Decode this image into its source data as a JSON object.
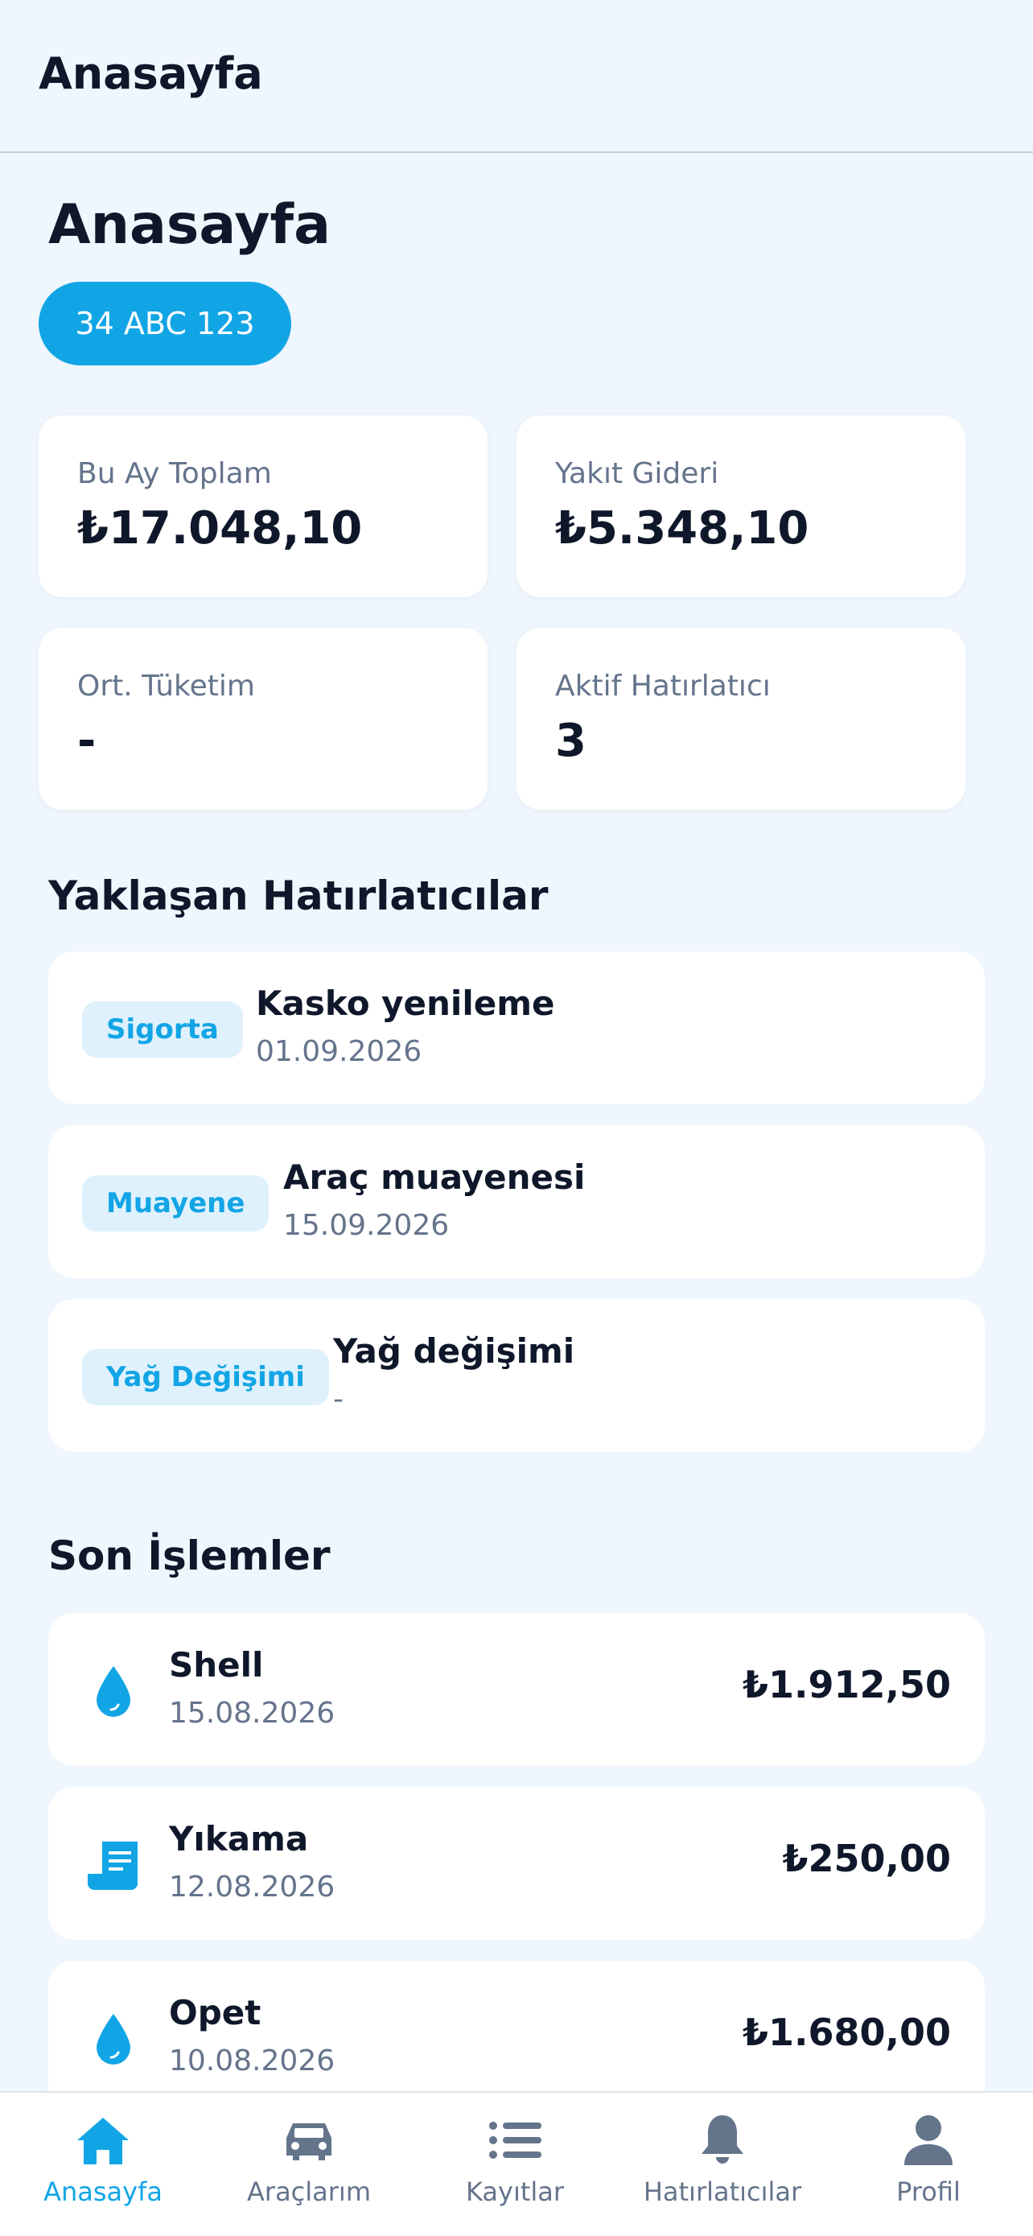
{
  "header": {
    "title": "Anasayfa"
  },
  "page": {
    "title": "Anasayfa",
    "plate": "34 ABC 123"
  },
  "stats": [
    {
      "label": "Bu Ay Toplam",
      "value": "₺17.048,10"
    },
    {
      "label": "Yakıt Gideri",
      "value": "₺5.348,10"
    },
    {
      "label": "Ort. Tüketim",
      "value": "-"
    },
    {
      "label": "Aktif Hatırlatıcı",
      "value": "3"
    }
  ],
  "reminders": {
    "title": "Yaklaşan Hatırlatıcılar",
    "items": [
      {
        "tag": "Sigorta",
        "title": "Kasko yenileme",
        "date": "01.09.2026"
      },
      {
        "tag": "Muayene",
        "title": "Araç muayenesi",
        "date": "15.09.2026"
      },
      {
        "tag": "Yağ Değişimi",
        "title": "Yağ değişimi",
        "date": "-"
      }
    ]
  },
  "transactions": {
    "title": "Son İşlemler",
    "items": [
      {
        "icon": "fuel-drop-icon",
        "title": "Shell",
        "date": "15.08.2026",
        "amount": "₺1.912,50"
      },
      {
        "icon": "receipt-icon",
        "title": "Yıkama",
        "date": "12.08.2026",
        "amount": "₺250,00"
      },
      {
        "icon": "fuel-drop-icon",
        "title": "Opet",
        "date": "10.08.2026",
        "amount": "₺1.680,00"
      }
    ]
  },
  "nav": {
    "items": [
      {
        "label": "Anasayfa",
        "icon": "home-icon",
        "active": true
      },
      {
        "label": "Araçlarım",
        "icon": "car-icon",
        "active": false
      },
      {
        "label": "Kayıtlar",
        "icon": "list-icon",
        "active": false
      },
      {
        "label": "Hatırlatıcılar",
        "icon": "bell-icon",
        "active": false
      },
      {
        "label": "Profil",
        "icon": "person-icon",
        "active": false
      }
    ]
  },
  "colors": {
    "accent": "#12a5e6",
    "background": "#eff6fd",
    "muted": "#64748b",
    "text": "#0f172a"
  }
}
